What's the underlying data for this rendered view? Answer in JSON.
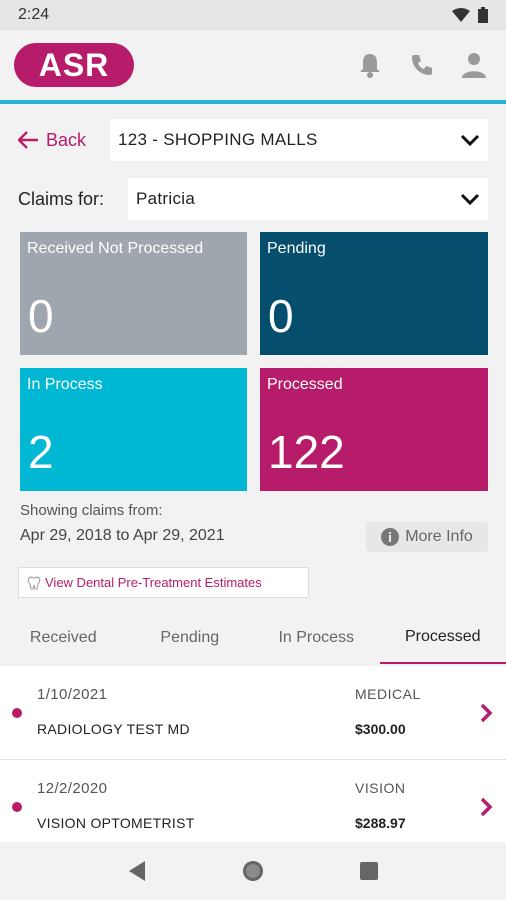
{
  "status_bar": {
    "time": "2:24"
  },
  "app": {
    "logo": "ASR"
  },
  "header": {
    "back_label": "Back",
    "group_select": "123 - SHOPPING MALLS"
  },
  "claims_for": {
    "label": "Claims for:",
    "value": "Patricia"
  },
  "tiles": [
    {
      "label": "Received Not Processed",
      "value": "0",
      "color": "#9fa6ad"
    },
    {
      "label": "Pending",
      "value": "0",
      "color": "#064e6e"
    },
    {
      "label": "In Process",
      "value": "2",
      "color": "#00b8d4"
    },
    {
      "label": "Processed",
      "value": "122",
      "color": "#b71c6b"
    }
  ],
  "date_range": {
    "label": "Showing claims from:",
    "range": "Apr 29, 2018 to Apr 29, 2021"
  },
  "more_info": "More Info",
  "dental_link": "View Dental Pre-Treatment Estimates",
  "tabs": [
    "Received",
    "Pending",
    "In Process",
    "Processed"
  ],
  "active_tab": "Processed",
  "claims": [
    {
      "date": "1/10/2021",
      "provider": "RADIOLOGY TEST MD",
      "type": "MEDICAL",
      "amount": "$300.00"
    },
    {
      "date": "12/2/2020",
      "provider": "VISION OPTOMETRIST",
      "type": "VISION",
      "amount": "$288.97"
    }
  ],
  "colors": {
    "brand": "#b71c6b",
    "accent": "#27b4d6"
  },
  "icons": [
    "wifi-icon",
    "battery-icon",
    "bell-icon",
    "phone-icon",
    "user-icon",
    "back-arrow-icon",
    "chevron-down-icon",
    "info-icon",
    "tooth-icon",
    "chevron-right-icon",
    "nav-back-icon",
    "nav-home-icon",
    "nav-recents-icon"
  ]
}
